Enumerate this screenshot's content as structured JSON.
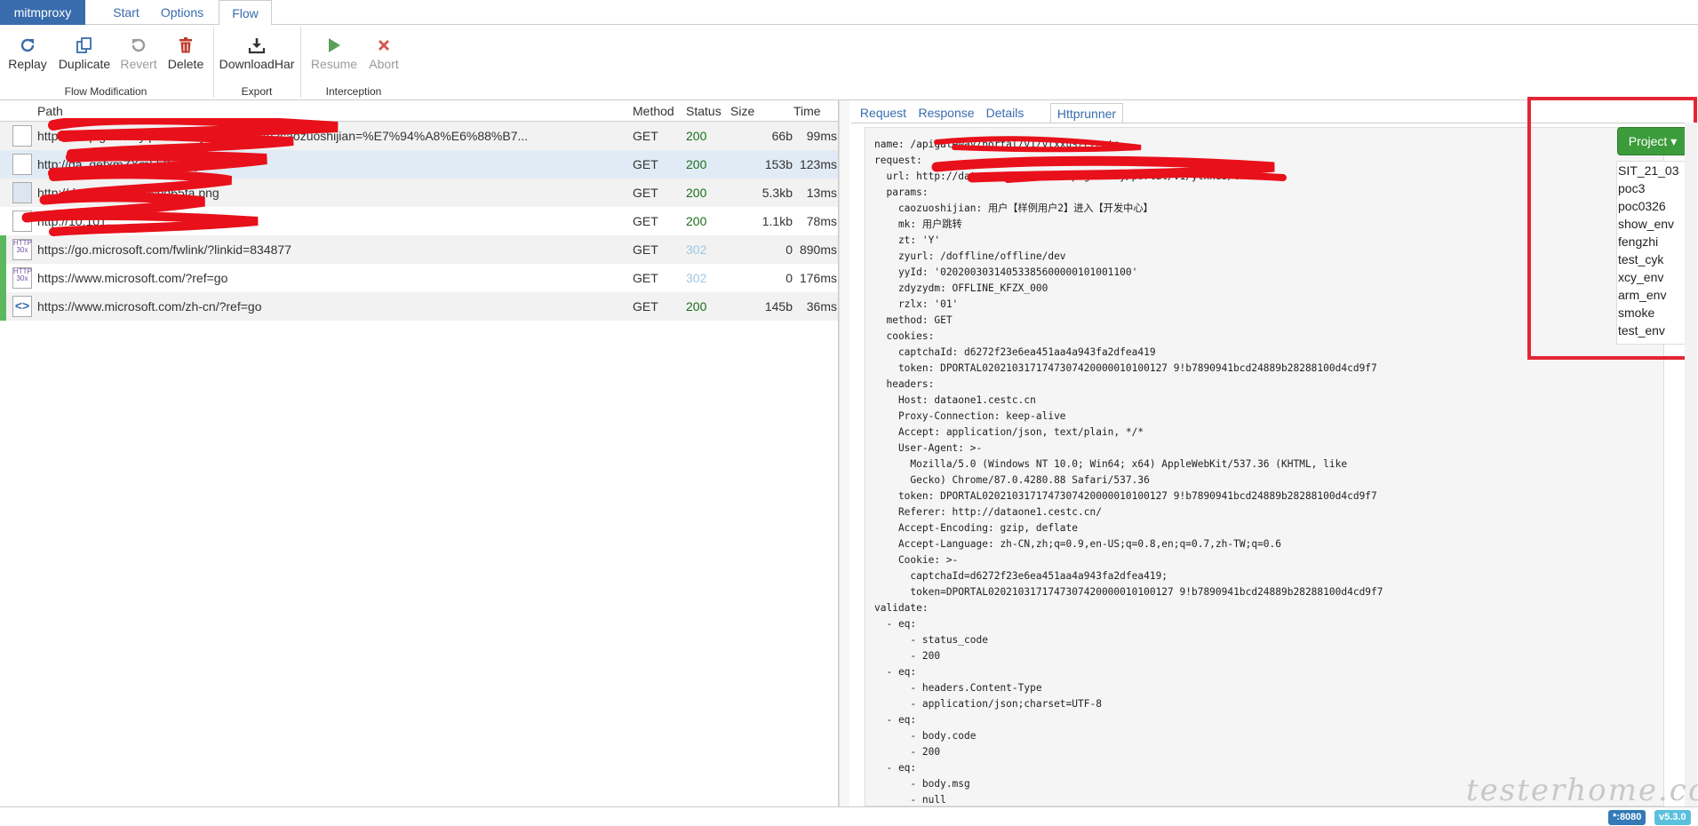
{
  "top_tabs": {
    "brand": "mitmproxy",
    "start": "Start",
    "options": "Options",
    "flow": "Flow"
  },
  "toolbar": {
    "replay": "Replay",
    "duplicate": "Duplicate",
    "revert": "Revert",
    "delete": "Delete",
    "download_har": "DownloadHar",
    "resume": "Resume",
    "abort": "Abort",
    "group_flow_modification": "Flow Modification",
    "group_export": "Export",
    "group_interception": "Interception"
  },
  "flow_table": {
    "headers": {
      "path": "Path",
      "method": "Method",
      "status": "Status",
      "size": "Size",
      "time": "Time"
    },
    "rows": [
      {
        "path": "http://d                     .apigateway/portal/v1/ytxxus/create?caozuoshijian=%E7%94%A8%E6%88%B7...",
        "method": "GET",
        "status": "200",
        "size": "66b",
        "time": "99ms"
      },
      {
        "path": "http://da                                           .getxmZXmLb?xmKjlx=",
        "method": "GET",
        "status": "200",
        "size": "153b",
        "time": "123ms"
      },
      {
        "path": "http://data                                    img/403.9cbd65fa.png",
        "method": "GET",
        "status": "200",
        "size": "5.3kb",
        "time": "13ms"
      },
      {
        "path": "http://10.101.                        ",
        "method": "GET",
        "status": "200",
        "size": "1.1kb",
        "time": "78ms"
      },
      {
        "path": "https://go.microsoft.com/fwlink/?linkid=834877",
        "method": "GET",
        "status": "302",
        "size": "0",
        "time": "890ms"
      },
      {
        "path": "https://www.microsoft.com/?ref=go",
        "method": "GET",
        "status": "302",
        "size": "0",
        "time": "176ms"
      },
      {
        "path": "https://www.microsoft.com/zh-cn/?ref=go",
        "method": "GET",
        "status": "200",
        "size": "145b",
        "time": "36ms"
      }
    ]
  },
  "detail_tabs": {
    "request": "Request",
    "response": "Response",
    "details": "Details",
    "httprunner": "Httprunner"
  },
  "yaml_lines": [
    "name: /apigateway/portal/v1/ytxxus/create",
    "request:",
    "  url: http://dataone1.cestc.cn/apigateway/portal/v1/ytxxus/create",
    "  params:",
    "    caozuoshijian: 用户【样例用户2】进入【开发中心】",
    "    mk: 用户跳转",
    "    zt: 'Y'",
    "    zyurl: /doffline/offline/dev",
    "    yyId: '02020030314053385600000101001100'",
    "    zdyzydm: OFFLINE_KFZX_000",
    "    rzlx: '01'",
    "  method: GET",
    "  cookies:",
    "    captchaId: d6272f23e6ea451aa4a943fa2dfea419",
    "    token: DPORTAL0202103171747307420000010100127 9!b7890941bcd24889b28288100d4cd9f7",
    "  headers:",
    "    Host: dataone1.cestc.cn",
    "    Proxy-Connection: keep-alive",
    "    Accept: application/json, text/plain, */*",
    "    User-Agent: >-",
    "      Mozilla/5.0 (Windows NT 10.0; Win64; x64) AppleWebKit/537.36 (KHTML, like",
    "      Gecko) Chrome/87.0.4280.88 Safari/537.36",
    "    token: DPORTAL0202103171747307420000010100127 9!b7890941bcd24889b28288100d4cd9f7",
    "    Referer: http://dataone1.cestc.cn/",
    "    Accept-Encoding: gzip, deflate",
    "    Accept-Language: zh-CN,zh;q=0.9,en-US;q=0.8,en;q=0.7,zh-TW;q=0.6",
    "    Cookie: >-",
    "      captchaId=d6272f23e6ea451aa4a943fa2dfea419;",
    "      token=DPORTAL0202103171747307420000010100127 9!b7890941bcd24889b28288100d4cd9f7",
    "validate:",
    "  - eq:",
    "      - status_code",
    "      - 200",
    "  - eq:",
    "      - headers.Content-Type",
    "      - application/json;charset=UTF-8",
    "  - eq:",
    "      - body.code",
    "      - 200",
    "  - eq:",
    "      - body.msg",
    "      - null"
  ],
  "project": {
    "button_label": "Project",
    "items": [
      "SIT_21_03",
      "poc3",
      "poc0326",
      "show_env",
      "fengzhi",
      "test_cyk",
      "xcy_env",
      "arm_env",
      "smoke",
      "test_env"
    ]
  },
  "footer": {
    "port_badge": "*:8080",
    "version_badge": "v5.3.0"
  },
  "watermark": "testerhome.com",
  "colors": {
    "brand_blue": "#396cad",
    "status_ok": "#1a6f1a",
    "status_redirect": "#9fc7e6",
    "project_green": "#3c9c3c",
    "highlight_red": "#e32636",
    "flow_bar_green": "#5cb85c"
  }
}
